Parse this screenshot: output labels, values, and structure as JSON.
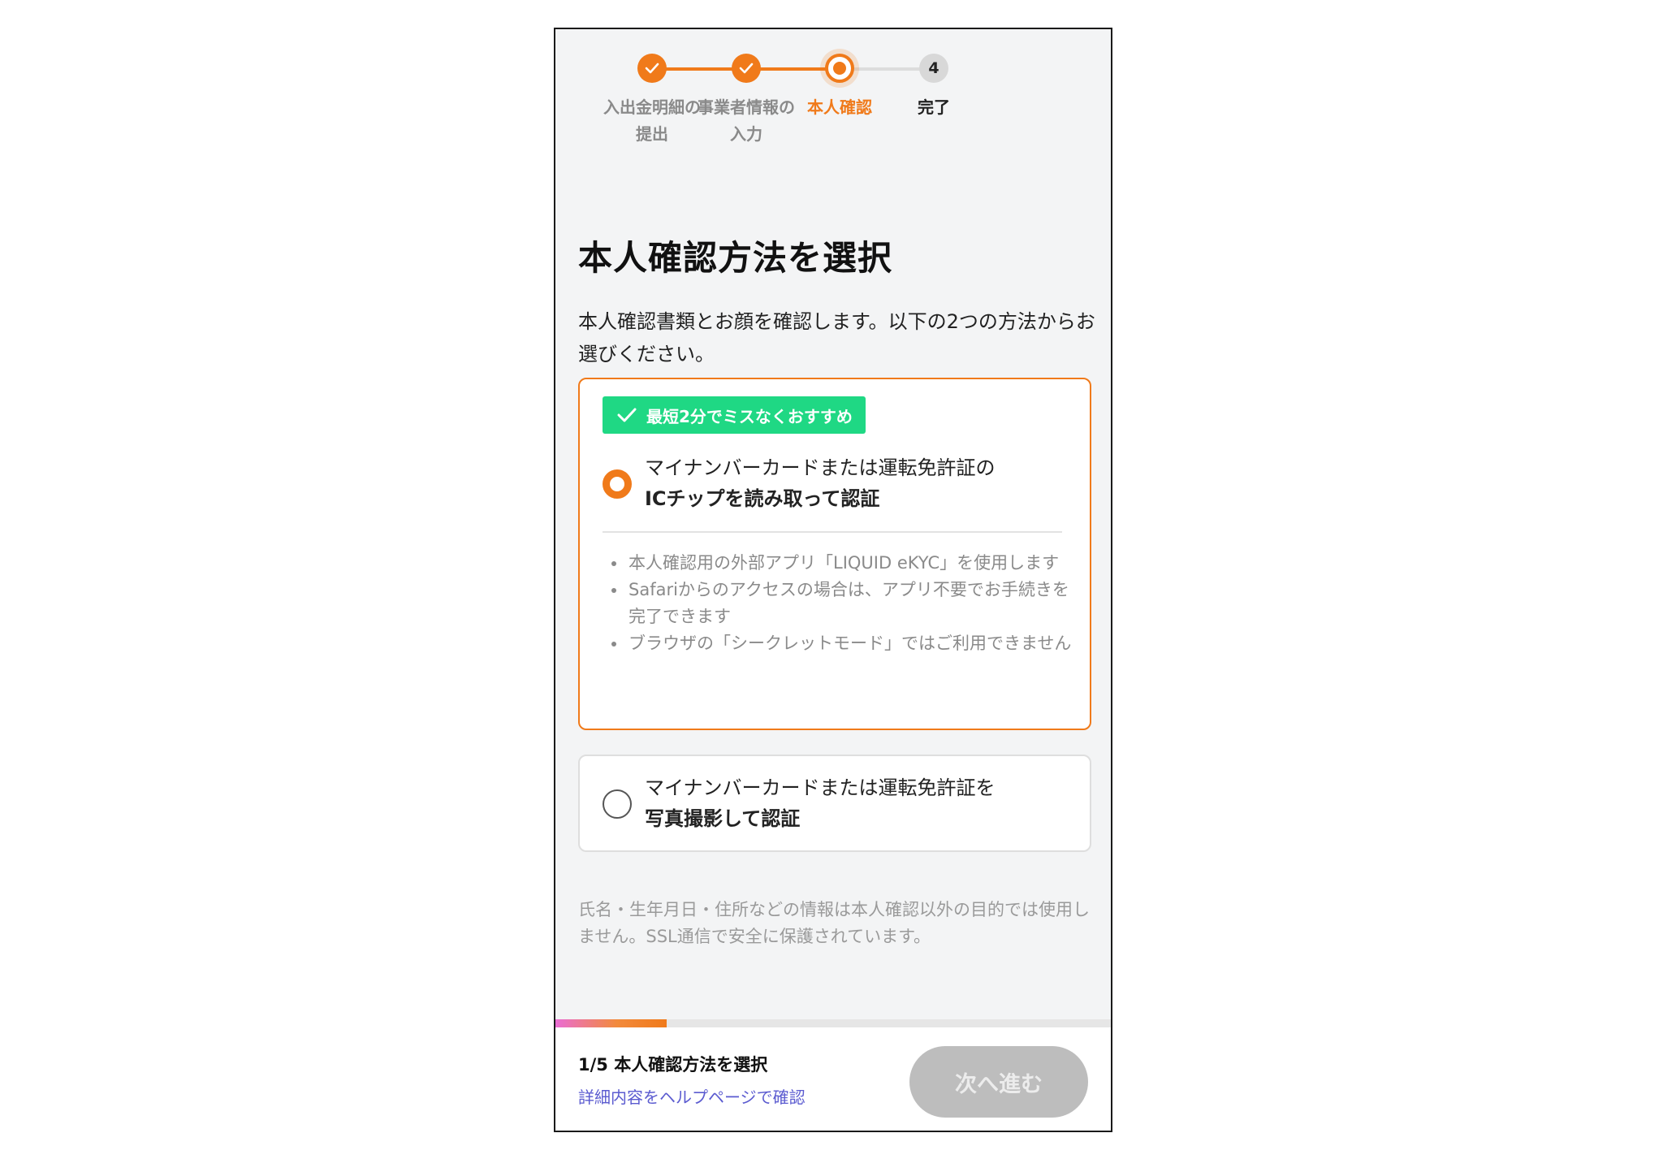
{
  "stepper": {
    "steps": [
      {
        "label": "入出金明細の\n提出",
        "state": "done"
      },
      {
        "label": "事業者情報の\n入力",
        "state": "done"
      },
      {
        "label": "本人確認",
        "state": "current"
      },
      {
        "label": "完了",
        "state": "todo",
        "number": "4"
      }
    ]
  },
  "page": {
    "title": "本人確認方法を選択",
    "description": "本人確認書類とお顔を確認します。以下の2つの方法からお選びください。"
  },
  "options": [
    {
      "badge": "最短2分でミスなくおすすめ",
      "line1": "マイナンバーカードまたは運転免許証の",
      "line2": "ICチップを読み取って認証",
      "selected": true,
      "notes": [
        "本人確認用の外部アプリ「LIQUID eKYC」を使用します",
        "Safariからのアクセスの場合は、アプリ不要でお手続きを完了できます",
        "ブラウザの「シークレットモード」ではご利用できません"
      ]
    },
    {
      "line1": "マイナンバーカードまたは運転免許証を",
      "line2": "写真撮影して認証",
      "selected": false
    }
  ],
  "privacy_note": "氏名・生年月日・住所などの情報は本人確認以外の目的では使用しません。SSL通信で安全に保護されています。",
  "footer": {
    "progress": 0.2,
    "step_text": "1/5 本人確認方法を選択",
    "help_link": "詳細内容をヘルプページで確認",
    "next_button": "次へ進む"
  },
  "colors": {
    "accent": "#f07a1a",
    "badge": "#1fd884",
    "link": "#5b5bd0",
    "button_disabled": "#bdbdbd"
  }
}
